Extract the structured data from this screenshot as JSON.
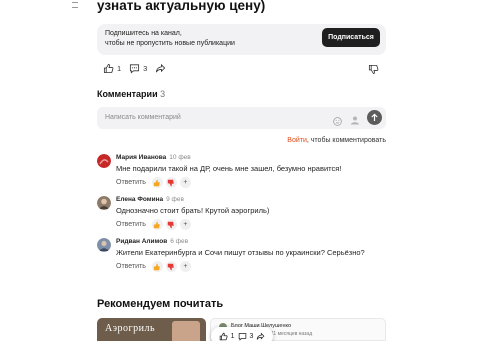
{
  "article": {
    "heading_tail": "узнать актуальную цену)"
  },
  "subscribe": {
    "text_line1": "Подпишитесь на канал,",
    "text_line2": "чтобы не пропустить новые публикации",
    "button_label": "Подписаться"
  },
  "reactions": {
    "likes": "1",
    "comments": "3"
  },
  "comments_section": {
    "title": "Комментарии",
    "count": "3",
    "input_placeholder": "Написать комментарий",
    "login_link": "Войти",
    "login_suffix": ", чтобы комментировать"
  },
  "comments": [
    {
      "author": "Мария Иванова",
      "date": "10 фев",
      "text": "Мне подарили такой на ДР, очень мне зашел, безумно нравится!",
      "reply_label": "Ответить"
    },
    {
      "author": "Елена Фомина",
      "date": "9 фев",
      "text": "Однозначно стоит брать! Крутой аэрогриль)",
      "reply_label": "Ответить"
    },
    {
      "author": "Ридван Алимов",
      "date": "6 фев",
      "text": "Жители Екатеринбурга и Сочи пишут отзывы по украински? Серьёзно?",
      "reply_label": "Ответить"
    }
  ],
  "recommend": {
    "title": "Рекомендуем почитать",
    "card_left_text": "Аэрогриль",
    "card_right_title": "Блог Маши Шелушенко",
    "card_right_meta": "11 месяцев назад"
  },
  "float_bar": {
    "likes": "1",
    "comments": "3"
  },
  "colors": {
    "accent_link": "#e64a19",
    "dark_button": "#1f1f1f",
    "card_bg": "#f2f2f4"
  }
}
